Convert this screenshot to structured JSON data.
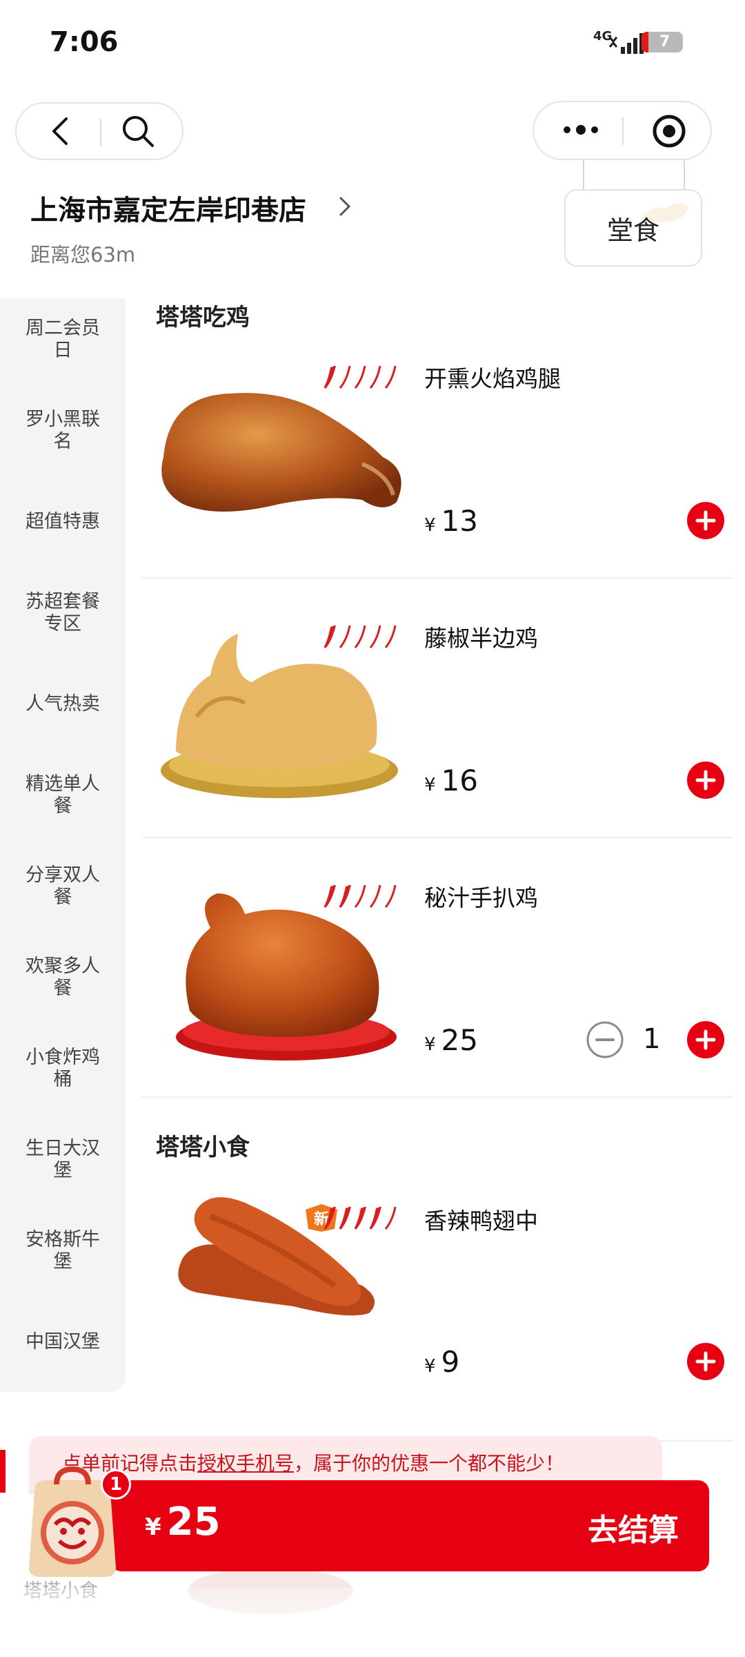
{
  "status": {
    "time": "7:06",
    "network": "4G",
    "battery": "7"
  },
  "store": {
    "name": "上海市嘉定左岸印巷店",
    "distance": "距离您63m",
    "dine_mode": "堂食"
  },
  "sidebar": {
    "categories": [
      "周二会员日",
      "罗小黑联名",
      "超值特惠",
      "苏超套餐专区",
      "人气热卖",
      "精选单人餐",
      "分享双人餐",
      "欢聚多人餐",
      "小食炸鸡桶",
      "生日大汉堡",
      "安格斯牛堡",
      "中国汉堡"
    ]
  },
  "sections": [
    {
      "title": "塔塔吃鸡",
      "items": [
        {
          "name": "开熏火焰鸡腿",
          "price": "13",
          "spice": 1,
          "quantity": 0
        },
        {
          "name": "藤椒半边鸡",
          "price": "16",
          "spice": 1,
          "quantity": 0
        },
        {
          "name": "秘汁手扒鸡",
          "price": "25",
          "spice": 2,
          "quantity": "1"
        }
      ]
    },
    {
      "title": "塔塔小食",
      "items": [
        {
          "name": "香辣鸭翅中",
          "price": "9",
          "spice": 4,
          "badge": "新",
          "quantity": 0
        }
      ]
    }
  ],
  "currency": "¥",
  "notice": {
    "before": "点单前记得点击",
    "link": "授权手机号",
    "after": "，属于你的优惠一个都不能少！"
  },
  "cart": {
    "count": "1",
    "total": "25",
    "checkout_label": "去结算"
  },
  "peek": {
    "category": "塔塔小食"
  },
  "colors": {
    "brand_red": "#e60012",
    "notice_bg": "#fde9ea"
  },
  "icons": [
    "back-icon",
    "search-icon",
    "more-icon",
    "target-icon",
    "chevron-right-icon",
    "plus-icon",
    "minus-icon",
    "pepper-icon",
    "cart-bag-icon"
  ]
}
